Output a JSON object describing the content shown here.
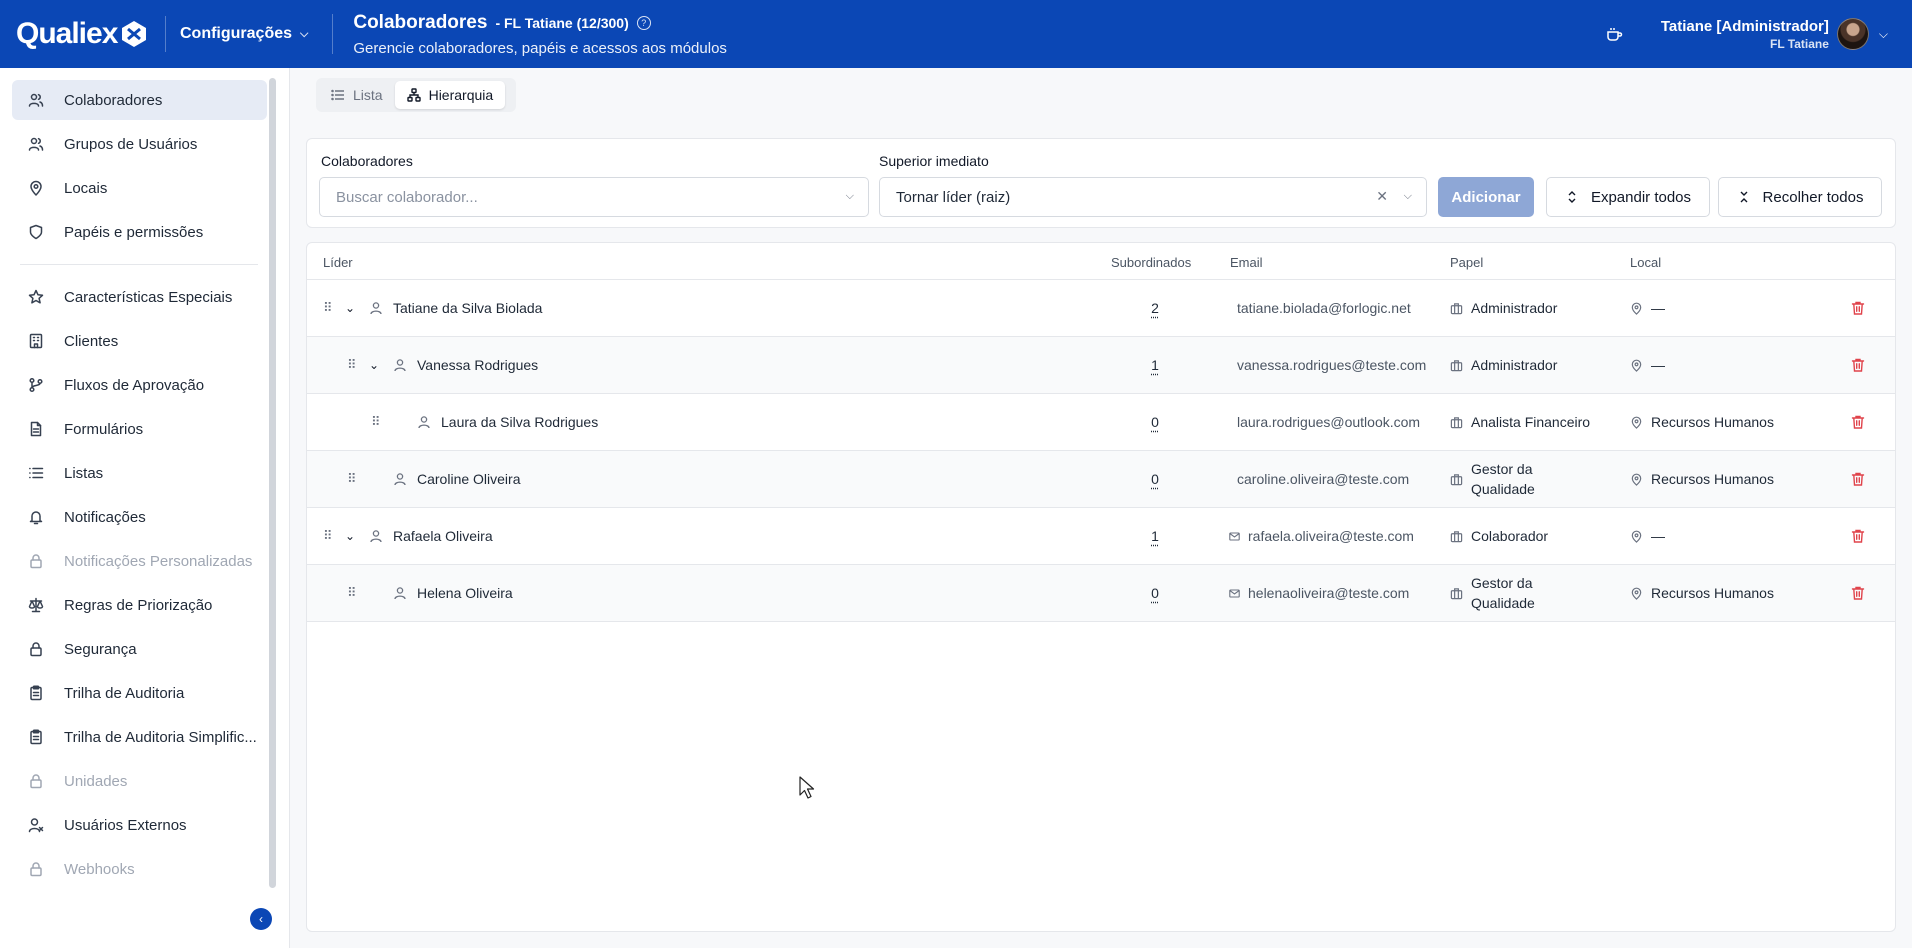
{
  "header": {
    "brand": "Qualiex",
    "module": "Configurações",
    "title": "Colaboradores",
    "subtitle": "- FL Tatiane (12/300)",
    "description": "Gerencie colaboradores, papéis e acessos aos módulos",
    "user_name": "Tatiane [Administrador]",
    "user_org": "FL Tatiane"
  },
  "sidebar": {
    "items": [
      {
        "label": "Colaboradores",
        "icon": "users-icon",
        "active": true
      },
      {
        "label": "Grupos de Usuários",
        "icon": "users-icon"
      },
      {
        "label": "Locais",
        "icon": "map-pin-icon"
      },
      {
        "label": "Papéis e permissões",
        "icon": "shield-icon"
      },
      {
        "label": "Características Especiais",
        "icon": "star-icon"
      },
      {
        "label": "Clientes",
        "icon": "building-icon"
      },
      {
        "label": "Fluxos de Aprovação",
        "icon": "git-branch-icon"
      },
      {
        "label": "Formulários",
        "icon": "file-icon"
      },
      {
        "label": "Listas",
        "icon": "list-icon"
      },
      {
        "label": "Notificações",
        "icon": "bell-icon"
      },
      {
        "label": "Notificações Personalizadas",
        "icon": "lock-icon",
        "disabled": true
      },
      {
        "label": "Regras de Priorização",
        "icon": "scale-icon"
      },
      {
        "label": "Segurança",
        "icon": "lock-icon"
      },
      {
        "label": "Trilha de Auditoria",
        "icon": "clipboard-icon"
      },
      {
        "label": "Trilha de Auditoria Simplific...",
        "icon": "clipboard-icon"
      },
      {
        "label": "Unidades",
        "icon": "lock-icon",
        "disabled": true
      },
      {
        "label": "Usuários Externos",
        "icon": "user-x-icon"
      },
      {
        "label": "Webhooks",
        "icon": "lock-icon",
        "disabled": true
      }
    ]
  },
  "tabs": [
    {
      "label": "Lista",
      "icon": "list-icon"
    },
    {
      "label": "Hierarquia",
      "icon": "hierarchy-icon",
      "active": true
    }
  ],
  "filters": {
    "collaborators_label": "Colaboradores",
    "collaborators_placeholder": "Buscar colaborador...",
    "superior_label": "Superior imediato",
    "superior_value": "Tornar líder (raiz)",
    "add_label": "Adicionar",
    "expand_label": "Expandir todos",
    "collapse_label": "Recolher todos"
  },
  "table": {
    "columns": [
      "Líder",
      "Subordinados",
      "Email",
      "Papel",
      "Local"
    ],
    "rows": [
      {
        "name": "Tatiane da Silva Biolada",
        "subordinates": "2",
        "email": "tatiane.biolada@forlogic.net",
        "role": "Administrador",
        "location": "—",
        "level": 0,
        "expandable": true
      },
      {
        "name": "Vanessa Rodrigues",
        "subordinates": "1",
        "email": "vanessa.rodrigues@teste.com",
        "role": "Administrador",
        "location": "—",
        "level": 1,
        "expandable": true
      },
      {
        "name": "Laura da Silva Rodrigues",
        "subordinates": "0",
        "email": "laura.rodrigues@outlook.com",
        "role": "Analista Financeiro",
        "location": "Recursos Humanos",
        "level": 2,
        "expandable": false
      },
      {
        "name": "Caroline Oliveira",
        "subordinates": "0",
        "email": "caroline.oliveira@teste.com",
        "role": "Gestor da Qualidade",
        "location": "Recursos Humanos",
        "level": 1,
        "expandable": false
      },
      {
        "name": "Rafaela Oliveira",
        "subordinates": "1",
        "email": "rafaela.oliveira@teste.com",
        "role": "Colaborador",
        "location": "—",
        "level": 0,
        "expandable": true
      },
      {
        "name": "Helena Oliveira",
        "subordinates": "0",
        "email": "helenaoliveira@teste.com",
        "role": "Gestor da Qualidade",
        "location": "Recursos Humanos",
        "level": 1,
        "expandable": false
      }
    ]
  },
  "colors": {
    "brand": "#0b47b5",
    "primary_disabled": "#8ea7d6",
    "danger": "#e0434b"
  }
}
